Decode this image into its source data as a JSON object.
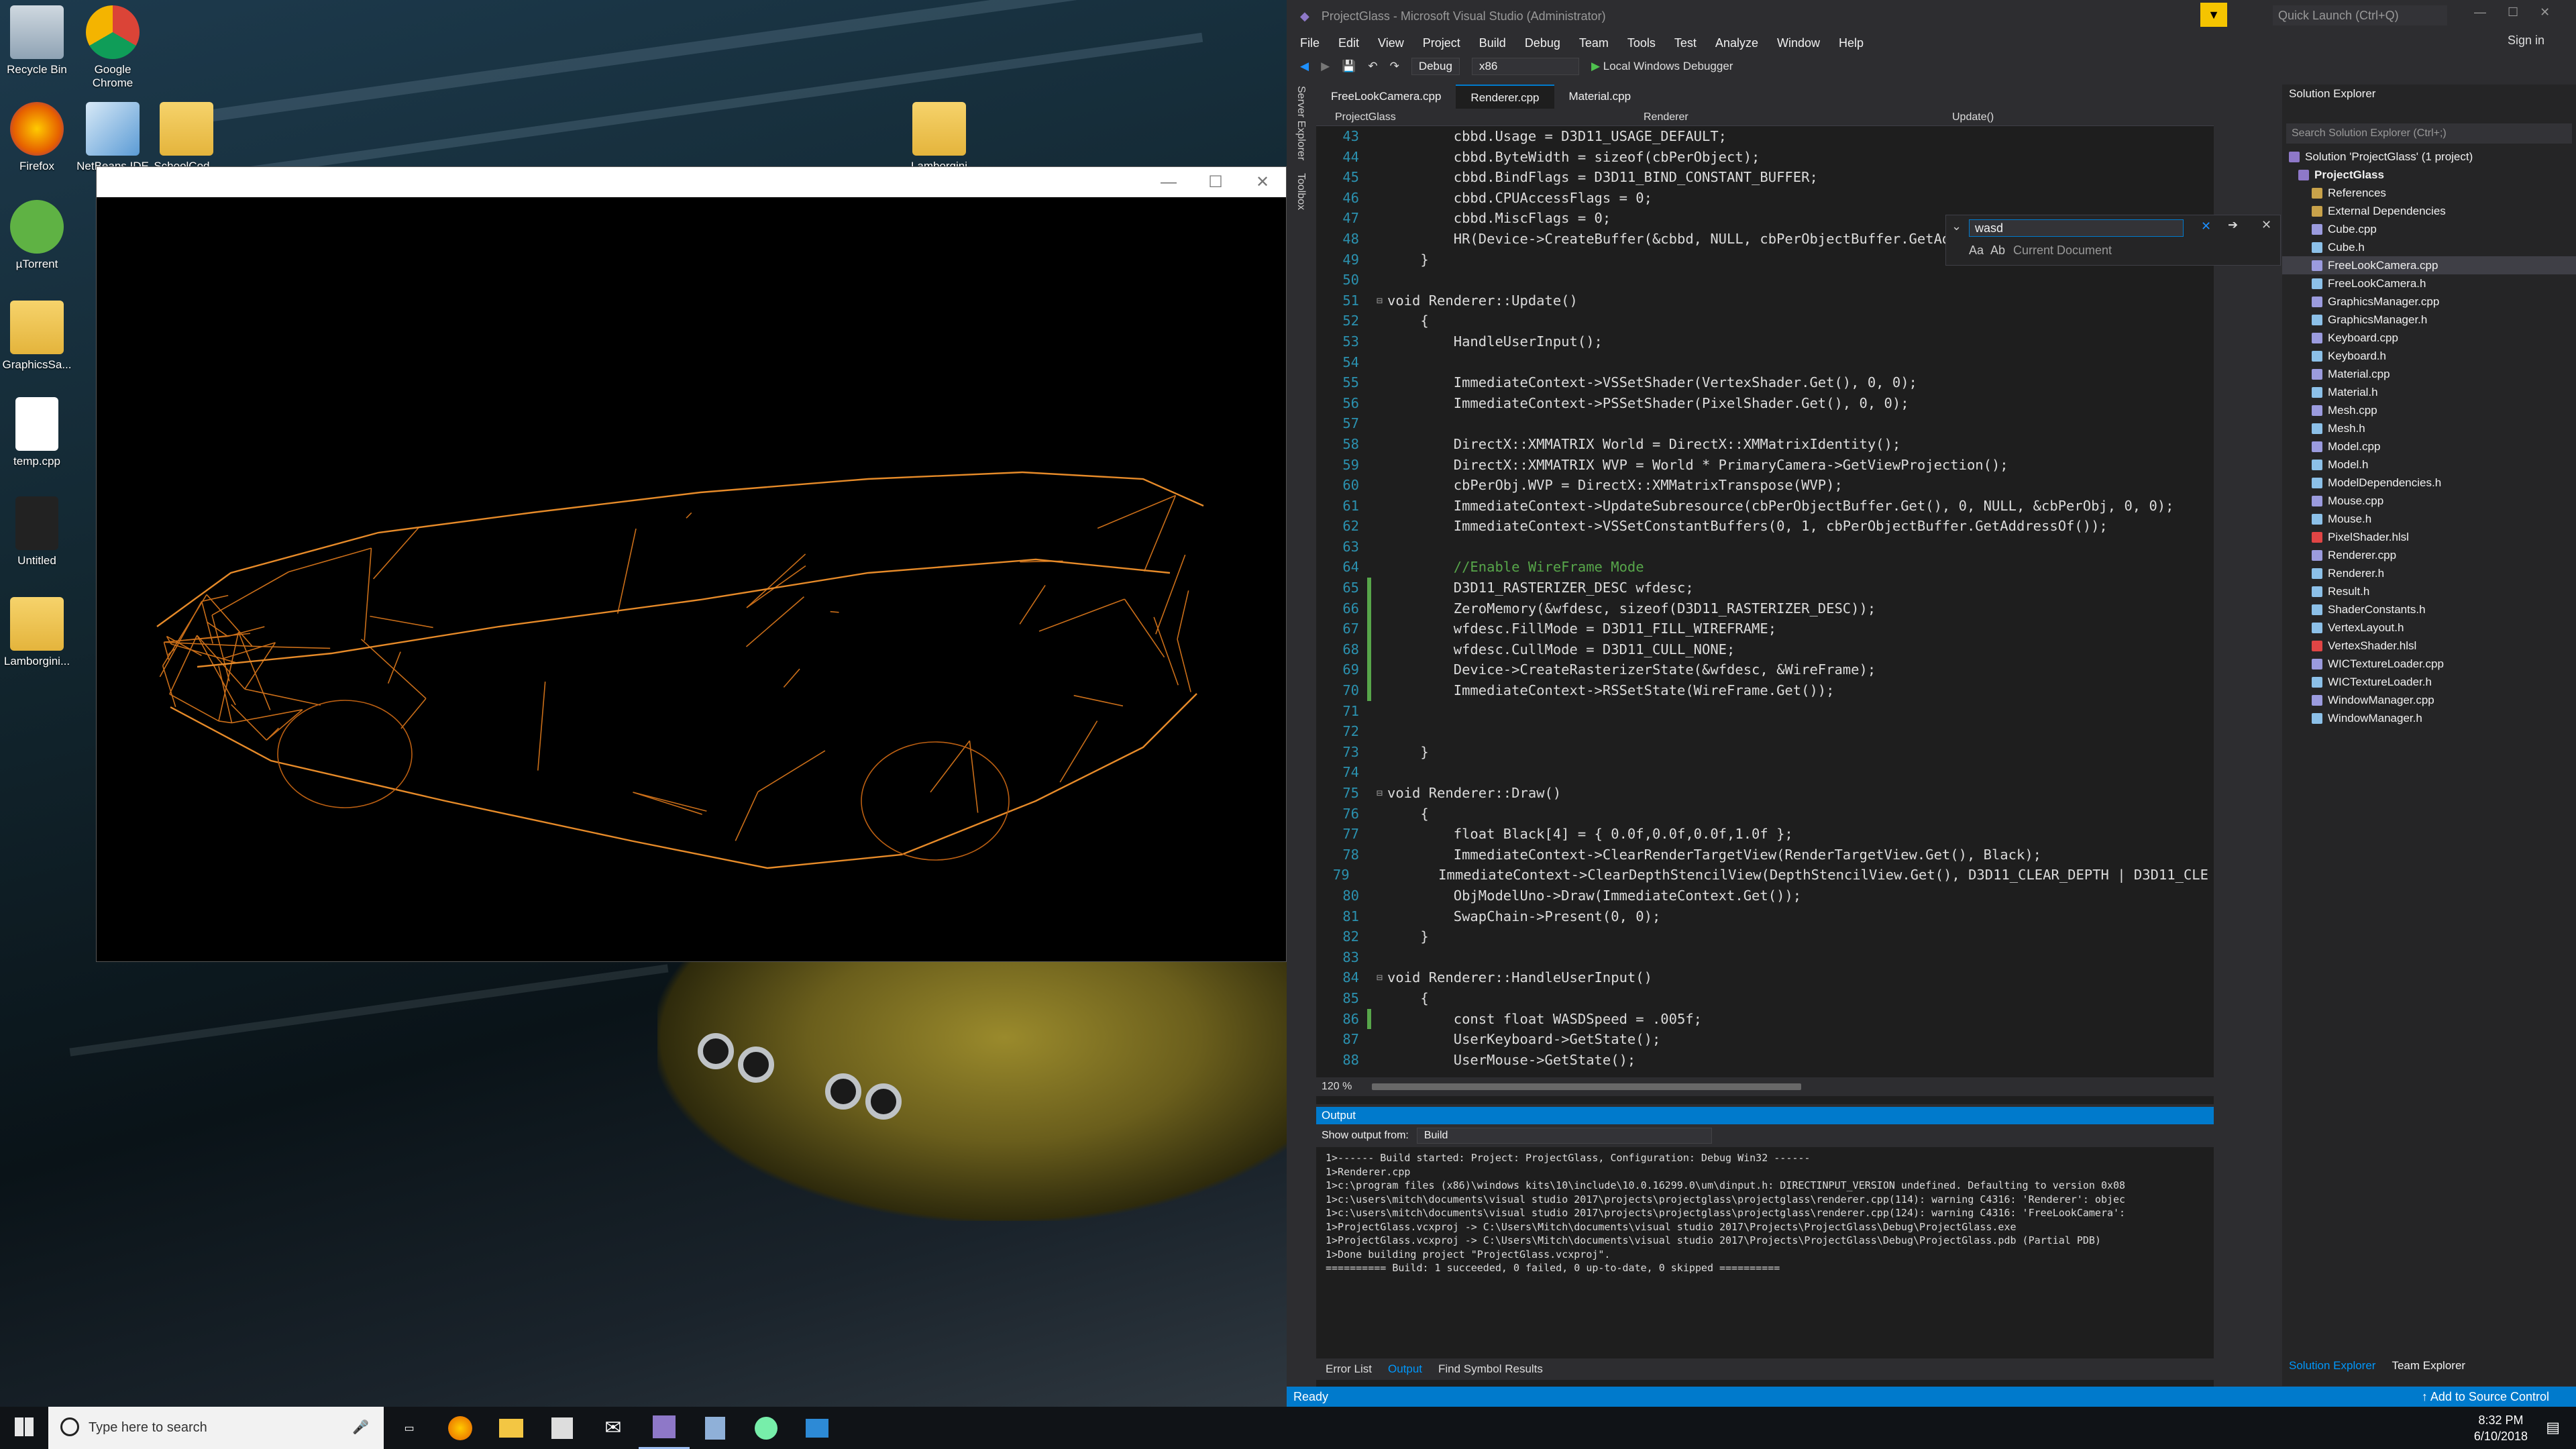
{
  "desktop": {
    "icons": [
      {
        "label": "Recycle Bin",
        "icon": "recycle-bin-icon"
      },
      {
        "label": "Google\nChrome",
        "icon": "chrome-icon"
      },
      {
        "label": "Firefox",
        "icon": "firefox-icon"
      },
      {
        "label": "NetBeans IDE",
        "icon": "netbeans-icon"
      },
      {
        "label": "SchoolCod...",
        "icon": "folder-icon"
      },
      {
        "label": "µTorrent",
        "icon": "utorrent-icon"
      },
      {
        "label": "GraphicsSa...",
        "icon": "folder-icon"
      },
      {
        "label": "temp.cpp",
        "icon": "file-icon"
      },
      {
        "label": "Untitled",
        "icon": "file-icon"
      },
      {
        "label": "Lamborgini...",
        "icon": "folder-icon"
      },
      {
        "label": "Lamborgini",
        "icon": "folder-icon"
      }
    ]
  },
  "render_window": {
    "minimize": "—",
    "maximize": "☐",
    "close": "✕"
  },
  "vs": {
    "title": "ProjectGlass - Microsoft Visual Studio (Administrator)",
    "quick_launch": "Quick Launch (Ctrl+Q)",
    "sign_in": "Sign in",
    "menu": [
      "File",
      "Edit",
      "View",
      "Project",
      "Build",
      "Debug",
      "Team",
      "Tools",
      "Test",
      "Analyze",
      "Window",
      "Help"
    ],
    "toolbar": {
      "config": "Debug",
      "platform": "x86",
      "debugger": "Local Windows Debugger"
    },
    "side_labels": [
      "Server Explorer",
      "Toolbox"
    ],
    "tabs": [
      {
        "label": "FreeLookCamera.cpp",
        "active": false
      },
      {
        "label": "Renderer.cpp",
        "active": true
      },
      {
        "label": "Material.cpp",
        "active": false
      }
    ],
    "nav": {
      "project": "ProjectGlass",
      "scope": "Renderer",
      "member": "Update()"
    },
    "find": {
      "value": "wasd",
      "scope": "Current Document",
      "aa": "Aa",
      "ab": "Ab"
    },
    "code": [
      {
        "n": "43",
        "t": "        cbbd.Usage = D3D11_USAGE_DEFAULT;",
        "c": false
      },
      {
        "n": "44",
        "t": "        cbbd.ByteWidth = sizeof(cbPerObject);",
        "c": false
      },
      {
        "n": "45",
        "t": "        cbbd.BindFlags = D3D11_BIND_CONSTANT_BUFFER;",
        "c": false
      },
      {
        "n": "46",
        "t": "        cbbd.CPUAccessFlags = 0;",
        "c": false
      },
      {
        "n": "47",
        "t": "        cbbd.MiscFlags = 0;",
        "c": false
      },
      {
        "n": "48",
        "t": "        HR(Device->CreateBuffer(&cbbd, NULL, cbPerObjectBuffer.GetAddressOf()));",
        "c": false
      },
      {
        "n": "49",
        "t": "    }",
        "c": false
      },
      {
        "n": "50",
        "t": "",
        "c": false
      },
      {
        "n": "51",
        "t": "void Renderer::Update()",
        "c": false,
        "fold": true
      },
      {
        "n": "52",
        "t": "    {",
        "c": false
      },
      {
        "n": "53",
        "t": "        HandleUserInput();",
        "c": false
      },
      {
        "n": "54",
        "t": "",
        "c": false
      },
      {
        "n": "55",
        "t": "        ImmediateContext->VSSetShader(VertexShader.Get(), 0, 0);",
        "c": false
      },
      {
        "n": "56",
        "t": "        ImmediateContext->PSSetShader(PixelShader.Get(), 0, 0);",
        "c": false
      },
      {
        "n": "57",
        "t": "",
        "c": false
      },
      {
        "n": "58",
        "t": "        DirectX::XMMATRIX World = DirectX::XMMatrixIdentity();",
        "c": false
      },
      {
        "n": "59",
        "t": "        DirectX::XMMATRIX WVP = World * PrimaryCamera->GetViewProjection();",
        "c": false
      },
      {
        "n": "60",
        "t": "        cbPerObj.WVP = DirectX::XMMatrixTranspose(WVP);",
        "c": false
      },
      {
        "n": "61",
        "t": "        ImmediateContext->UpdateSubresource(cbPerObjectBuffer.Get(), 0, NULL, &cbPerObj, 0, 0);",
        "c": false
      },
      {
        "n": "62",
        "t": "        ImmediateContext->VSSetConstantBuffers(0, 1, cbPerObjectBuffer.GetAddressOf());",
        "c": false
      },
      {
        "n": "63",
        "t": "",
        "c": false
      },
      {
        "n": "64",
        "t": "        //Enable WireFrame Mode",
        "c": false,
        "comment": true
      },
      {
        "n": "65",
        "t": "        D3D11_RASTERIZER_DESC wfdesc;",
        "c": true
      },
      {
        "n": "66",
        "t": "        ZeroMemory(&wfdesc, sizeof(D3D11_RASTERIZER_DESC));",
        "c": true
      },
      {
        "n": "67",
        "t": "        wfdesc.FillMode = D3D11_FILL_WIREFRAME;",
        "c": true
      },
      {
        "n": "68",
        "t": "        wfdesc.CullMode = D3D11_CULL_NONE;",
        "c": true
      },
      {
        "n": "69",
        "t": "        Device->CreateRasterizerState(&wfdesc, &WireFrame);",
        "c": true
      },
      {
        "n": "70",
        "t": "        ImmediateContext->RSSetState(WireFrame.Get());",
        "c": true
      },
      {
        "n": "71",
        "t": "",
        "c": false
      },
      {
        "n": "72",
        "t": "",
        "c": false
      },
      {
        "n": "73",
        "t": "    }",
        "c": false
      },
      {
        "n": "74",
        "t": "",
        "c": false
      },
      {
        "n": "75",
        "t": "void Renderer::Draw()",
        "c": false,
        "fold": true
      },
      {
        "n": "76",
        "t": "    {",
        "c": false
      },
      {
        "n": "77",
        "t": "        float Black[4] = { 0.0f,0.0f,0.0f,1.0f };",
        "c": false
      },
      {
        "n": "78",
        "t": "        ImmediateContext->ClearRenderTargetView(RenderTargetView.Get(), Black);",
        "c": false
      },
      {
        "n": "79",
        "t": "        ImmediateContext->ClearDepthStencilView(DepthStencilView.Get(), D3D11_CLEAR_DEPTH | D3D11_CLE",
        "c": false
      },
      {
        "n": "80",
        "t": "        ObjModelUno->Draw(ImmediateContext.Get());",
        "c": false
      },
      {
        "n": "81",
        "t": "        SwapChain->Present(0, 0);",
        "c": false
      },
      {
        "n": "82",
        "t": "    }",
        "c": false
      },
      {
        "n": "83",
        "t": "",
        "c": false
      },
      {
        "n": "84",
        "t": "void Renderer::HandleUserInput()",
        "c": false,
        "fold": true
      },
      {
        "n": "85",
        "t": "    {",
        "c": false
      },
      {
        "n": "86",
        "t": "        const float WASDSpeed = .005f;",
        "c": true
      },
      {
        "n": "87",
        "t": "        UserKeyboard->GetState();",
        "c": false
      },
      {
        "n": "88",
        "t": "        UserMouse->GetState();",
        "c": false
      }
    ],
    "zoom": "120 %",
    "output": {
      "title": "Output",
      "show_from_label": "Show output from:",
      "show_from_value": "Build",
      "lines": [
        "1>------ Build started: Project: ProjectGlass, Configuration: Debug Win32 ------",
        "1>Renderer.cpp",
        "1>c:\\program files (x86)\\windows kits\\10\\include\\10.0.16299.0\\um\\dinput.h: DIRECTINPUT_VERSION undefined. Defaulting to version 0x08",
        "1>c:\\users\\mitch\\documents\\visual studio 2017\\projects\\projectglass\\projectglass\\renderer.cpp(114): warning C4316: 'Renderer': objec",
        "1>c:\\users\\mitch\\documents\\visual studio 2017\\projects\\projectglass\\projectglass\\renderer.cpp(124): warning C4316: 'FreeLookCamera':",
        "1>ProjectGlass.vcxproj -> C:\\Users\\Mitch\\documents\\visual studio 2017\\Projects\\ProjectGlass\\Debug\\ProjectGlass.exe",
        "1>ProjectGlass.vcxproj -> C:\\Users\\Mitch\\documents\\visual studio 2017\\Projects\\ProjectGlass\\Debug\\ProjectGlass.pdb (Partial PDB)",
        "1>Done building project \"ProjectGlass.vcxproj\".",
        "========== Build: 1 succeeded, 0 failed, 0 up-to-date, 0 skipped =========="
      ]
    },
    "bottom_tabs": [
      "Error List",
      "Output",
      "Find Symbol Results"
    ],
    "solution": {
      "title": "Solution Explorer",
      "search": "Search Solution Explorer (Ctrl+;)",
      "root": "Solution 'ProjectGlass' (1 project)",
      "project": "ProjectGlass",
      "items": [
        "References",
        "External Dependencies",
        "Cube.cpp",
        "Cube.h",
        "FreeLookCamera.cpp",
        "FreeLookCamera.h",
        "GraphicsManager.cpp",
        "GraphicsManager.h",
        "Keyboard.cpp",
        "Keyboard.h",
        "Material.cpp",
        "Material.h",
        "Mesh.cpp",
        "Mesh.h",
        "Model.cpp",
        "Model.h",
        "ModelDependencies.h",
        "Mouse.cpp",
        "Mouse.h",
        "PixelShader.hlsl",
        "Renderer.cpp",
        "Renderer.h",
        "Result.h",
        "ShaderConstants.h",
        "VertexLayout.h",
        "VertexShader.hlsl",
        "WICTextureLoader.cpp",
        "WICTextureLoader.h",
        "WindowManager.cpp",
        "WindowManager.h"
      ],
      "selected": "FreeLookCamera.cpp",
      "footer_tabs": [
        "Solution Explorer",
        "Team Explorer"
      ]
    },
    "status": {
      "left": "Ready",
      "right": "Add to Source Control"
    }
  },
  "taskbar": {
    "search_placeholder": "Type here to search",
    "time": "8:32 PM",
    "date": "6/10/2018"
  }
}
